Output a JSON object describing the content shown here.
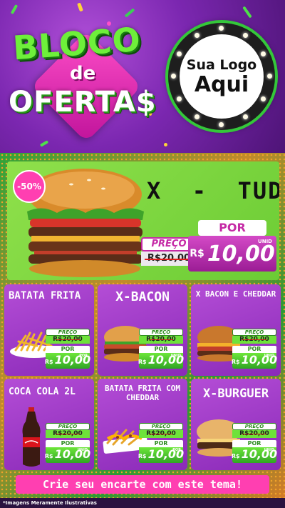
{
  "header": {
    "title_line1": "BLOCO",
    "title_line2": "de",
    "title_line3": "OFERTA$",
    "logo_line1": "Sua Logo",
    "logo_line2": "Aqui"
  },
  "hero": {
    "discount_badge": "-50%",
    "name": "X  -  TUDO",
    "preco_label": "PREÇO",
    "old_price": "R$20,00",
    "por_label": "POR",
    "currency": "R$",
    "new_price": "10,00",
    "unit": "UNID"
  },
  "products": [
    {
      "name": "BATATA FRITA",
      "preco_label": "PREÇO",
      "old_price": "R$20,00",
      "por_label": "POR",
      "currency": "R$",
      "new_price": "10,00",
      "unit": "POR"
    },
    {
      "name": "X-BACON",
      "preco_label": "PREÇO",
      "old_price": "R$20,00",
      "por_label": "POR",
      "currency": "R$",
      "new_price": "10,00",
      "unit": "UNID"
    },
    {
      "name": "X BACON E CHEDDAR",
      "preco_label": "PREÇO",
      "old_price": "R$20,00",
      "por_label": "POR",
      "currency": "R$",
      "new_price": "10,00",
      "unit": "UNID"
    },
    {
      "name": "COCA COLA 2L",
      "preco_label": "PREÇO",
      "old_price": "R$20,00",
      "por_label": "POR",
      "currency": "R$",
      "new_price": "10,00",
      "unit": "UNID"
    },
    {
      "name": "BATATA FRITA COM CHEDDAR",
      "preco_label": "PREÇO",
      "old_price": "R$20,00",
      "por_label": "POR",
      "currency": "R$",
      "new_price": "10,00",
      "unit": "POR"
    },
    {
      "name": "X-BURGUER",
      "preco_label": "PREÇO",
      "old_price": "R$20,00",
      "por_label": "POR",
      "currency": "R$",
      "new_price": "10,00",
      "unit": "UNID"
    }
  ],
  "cta": {
    "label": "Crie seu encarte com este tema!"
  },
  "footer": {
    "disclaimer": "*Imagens Meramente Ilustrativas"
  },
  "colors": {
    "purple": "#8a2ab8",
    "pink": "#ff3fb1",
    "green": "#6ccc35",
    "dark_green": "#2d8c1e"
  },
  "icons": [
    "burger-image",
    "fries-image",
    "cola-bottle-image",
    "cheddar-fries-image"
  ]
}
